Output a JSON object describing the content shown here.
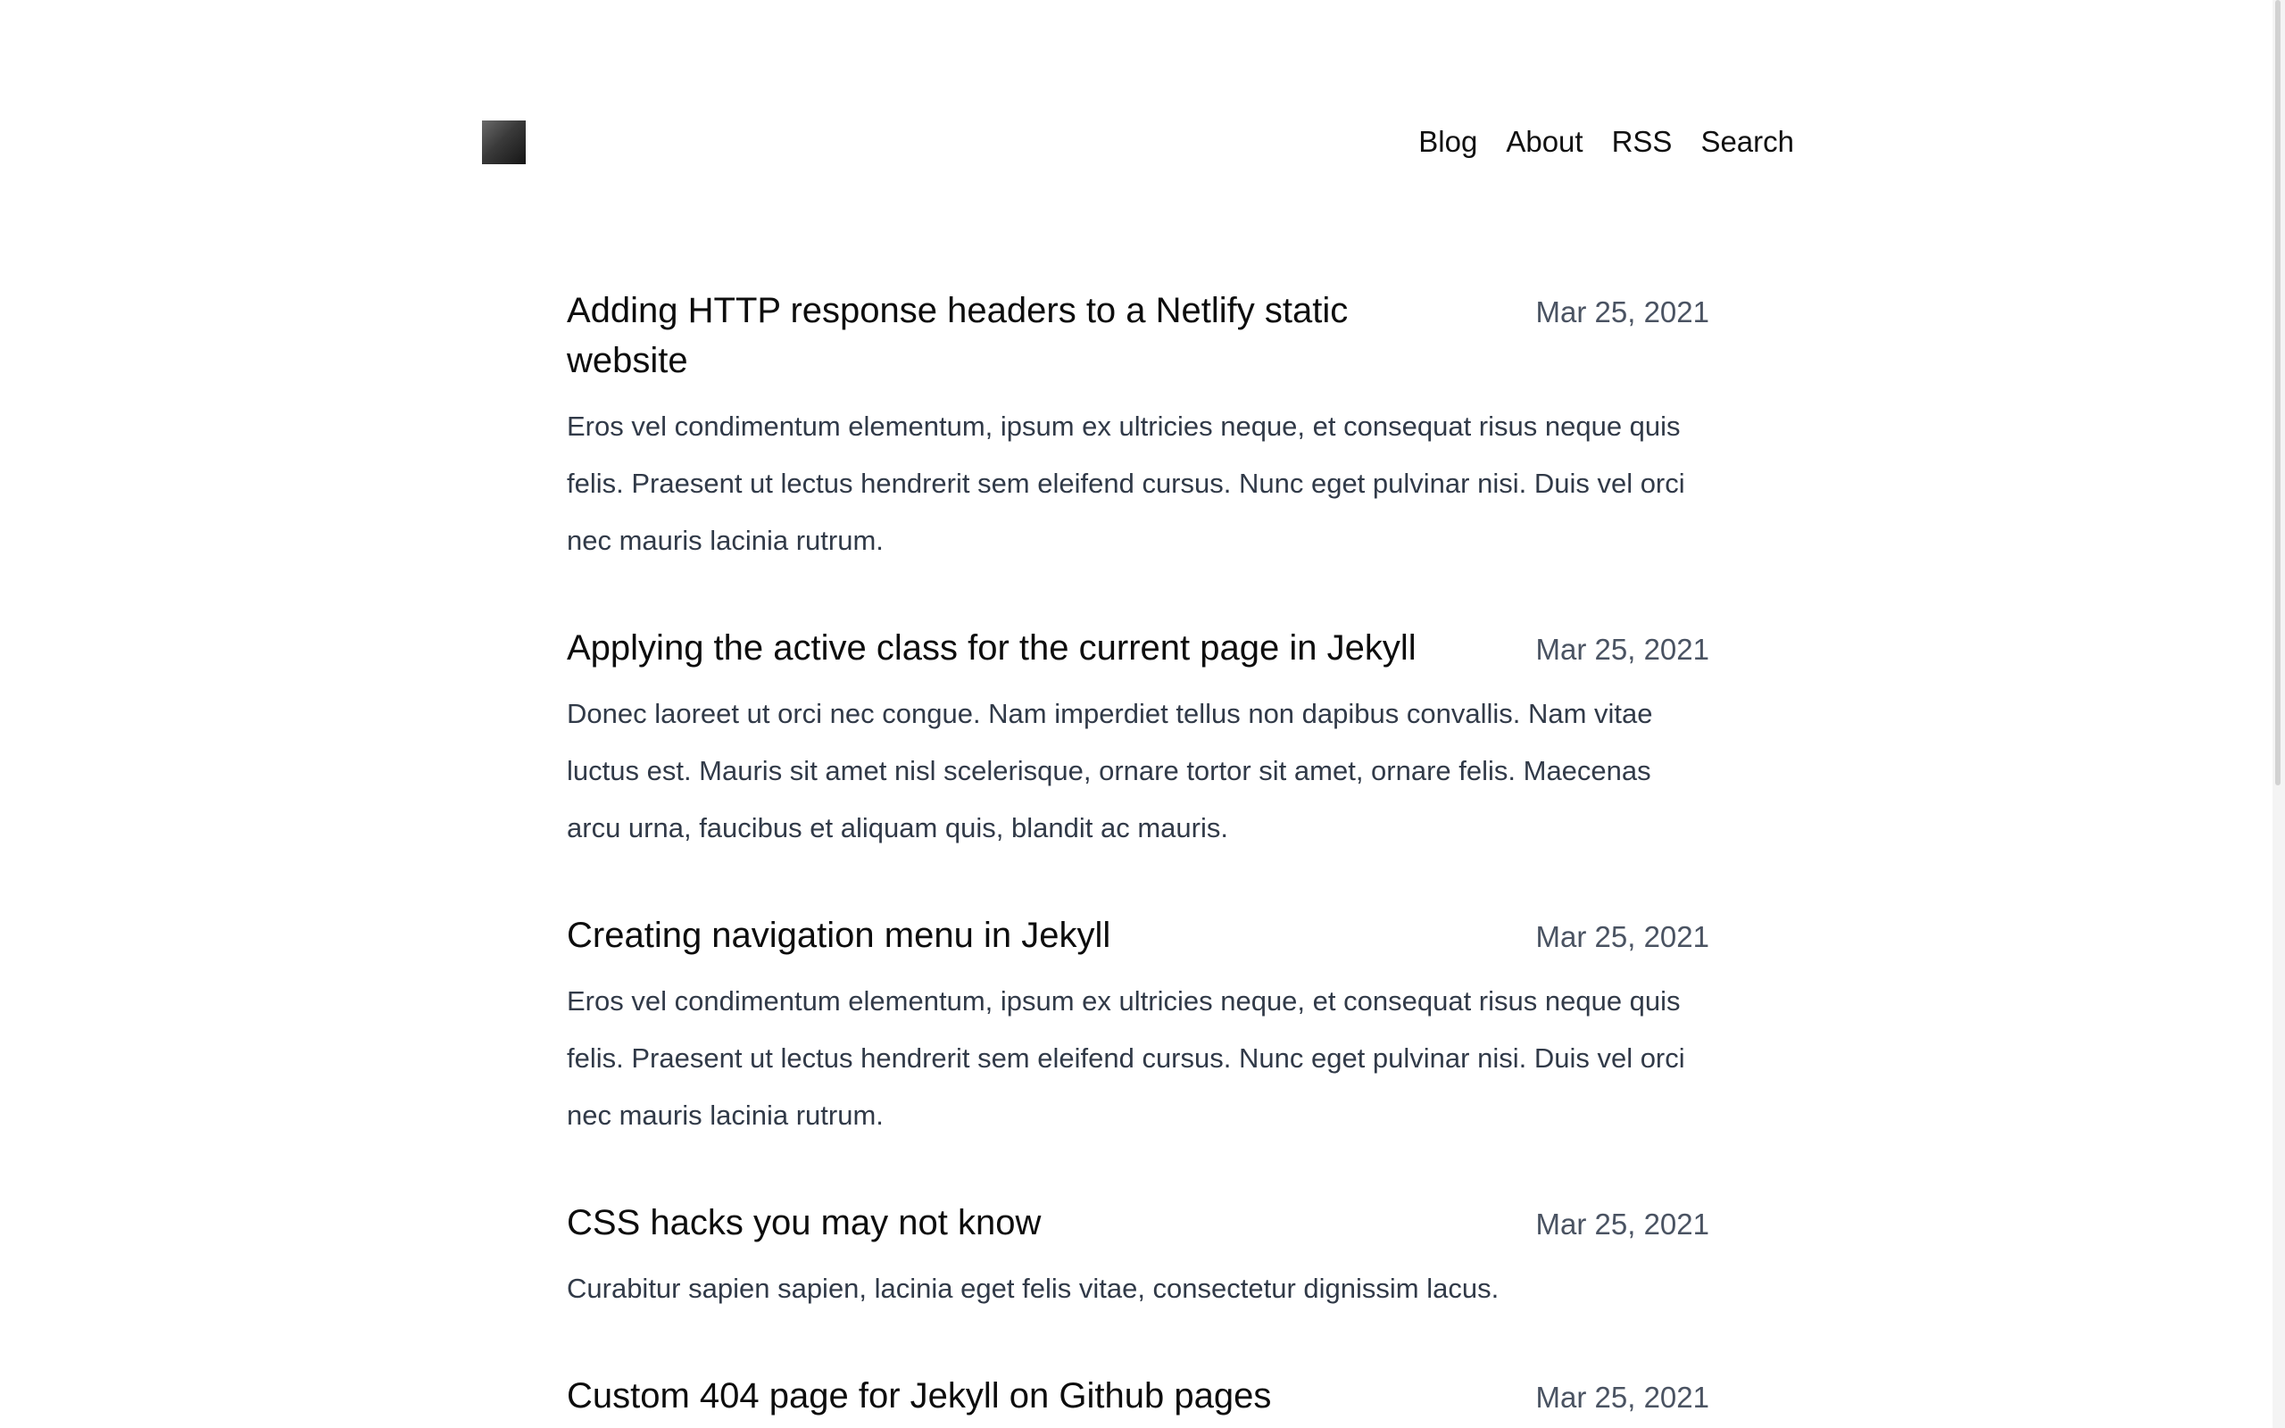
{
  "nav": {
    "items": [
      {
        "label": "Blog"
      },
      {
        "label": "About"
      },
      {
        "label": "RSS"
      },
      {
        "label": "Search"
      }
    ]
  },
  "posts": [
    {
      "title": "Adding HTTP response headers to a Netlify static website",
      "date": "Mar 25, 2021",
      "excerpt": "Eros vel condimentum elementum, ipsum ex ultricies neque, et consequat risus neque quis felis. Praesent ut lectus hendrerit sem eleifend cursus. Nunc eget pulvinar nisi. Duis vel orci nec mauris lacinia rutrum."
    },
    {
      "title": "Applying the active class for the current page in Jekyll",
      "date": "Mar 25, 2021",
      "excerpt": "Donec laoreet ut orci nec congue. Nam imperdiet tellus non dapibus convallis. Nam vitae luctus est. Mauris sit amet nisl scelerisque, ornare tortor sit amet, ornare felis. Maecenas arcu urna, faucibus et aliquam quis, blandit ac mauris."
    },
    {
      "title": "Creating navigation menu in Jekyll",
      "date": "Mar 25, 2021",
      "excerpt": "Eros vel condimentum elementum, ipsum ex ultricies neque, et consequat risus neque quis felis. Praesent ut lectus hendrerit sem eleifend cursus. Nunc eget pulvinar nisi. Duis vel orci nec mauris lacinia rutrum."
    },
    {
      "title": "CSS hacks you may not know",
      "date": "Mar 25, 2021",
      "excerpt": "Curabitur sapien sapien, lacinia eget felis vitae, consectetur dignissim lacus."
    },
    {
      "title": "Custom 404 page for Jekyll on Github pages",
      "date": "Mar 25, 2021",
      "excerpt": ""
    }
  ]
}
